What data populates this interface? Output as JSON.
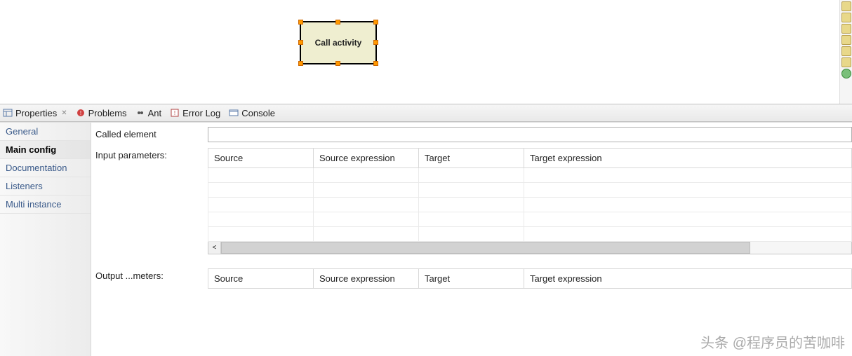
{
  "canvas": {
    "node_label": "Call activity"
  },
  "views": {
    "properties": "Properties",
    "problems": "Problems",
    "ant": "Ant",
    "error_log": "Error Log",
    "console": "Console"
  },
  "sidebar_tabs": {
    "general": "General",
    "main_config": "Main config",
    "documentation": "Documentation",
    "listeners": "Listeners",
    "multi_instance": "Multi instance"
  },
  "form": {
    "called_element_label": "Called element",
    "called_element_value": "",
    "input_parameters_label": "Input parameters:",
    "output_parameters_label": "Output ...meters:",
    "columns": {
      "source": "Source",
      "source_expression": "Source expression",
      "target": "Target",
      "target_expression": "Target expression"
    }
  },
  "watermark": "头条 @程序员的苦咖啡"
}
